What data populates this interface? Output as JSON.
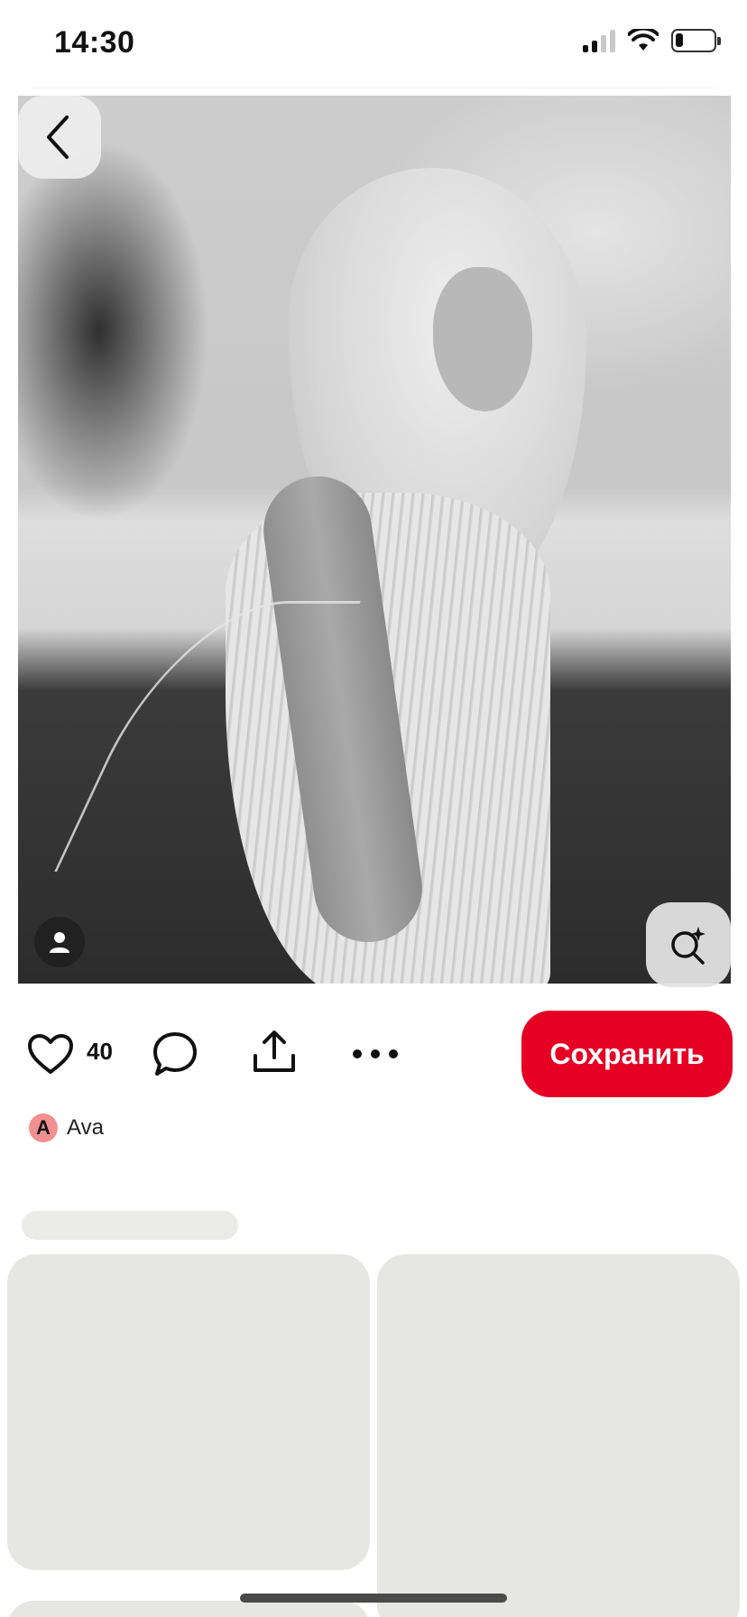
{
  "status_bar": {
    "time": "14:30",
    "signal_icon": "cellular-signal-icon",
    "wifi_icon": "wifi-icon",
    "battery_icon": "battery-icon",
    "battery_level": 0.2
  },
  "pin": {
    "image_description": "black-and-white-photo",
    "back_icon": "chevron-left-icon",
    "creator_icon": "person-icon",
    "visual_search_icon": "sparkle-search-icon"
  },
  "actions": {
    "like_icon": "heart-icon",
    "like_count": "40",
    "comment_icon": "speech-bubble-icon",
    "share_icon": "share-upload-icon",
    "more_icon": "more-horizontal-icon",
    "save_label": "Сохранить"
  },
  "author": {
    "initial": "A",
    "name": "Ava"
  },
  "colors": {
    "accent": "#e60023",
    "avatar_bg": "#f28f8f",
    "skeleton": "#e6e6e2"
  }
}
